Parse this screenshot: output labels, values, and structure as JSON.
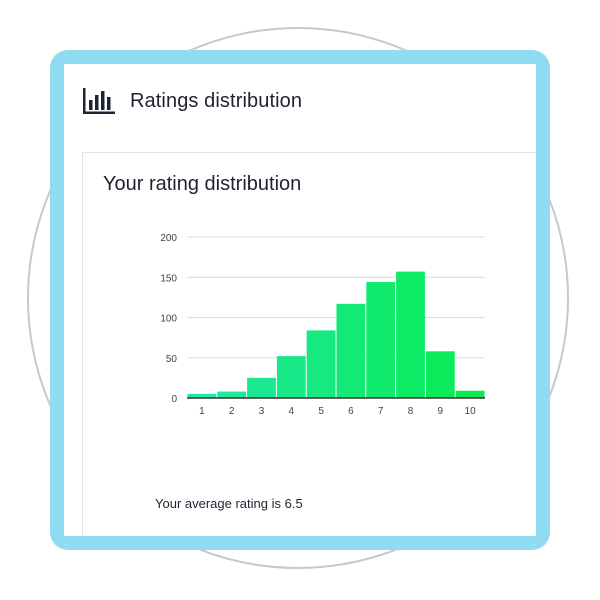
{
  "page": {
    "title": "Ratings distribution",
    "icon": "bar-chart-icon"
  },
  "card": {
    "title": "Your rating distribution",
    "average_text": "Your average rating is 6.5"
  },
  "chart_data": {
    "type": "bar",
    "title": "",
    "xlabel": "",
    "ylabel": "",
    "categories": [
      "1",
      "2",
      "3",
      "4",
      "5",
      "6",
      "7",
      "8",
      "9",
      "10"
    ],
    "values": [
      5,
      8,
      25,
      52,
      84,
      117,
      144,
      157,
      58,
      9
    ],
    "ylim": [
      0,
      200
    ],
    "yticks": [
      0,
      50,
      100,
      150,
      200
    ],
    "grid": true,
    "colors": [
      "#20e9a3",
      "#08ea52"
    ]
  }
}
